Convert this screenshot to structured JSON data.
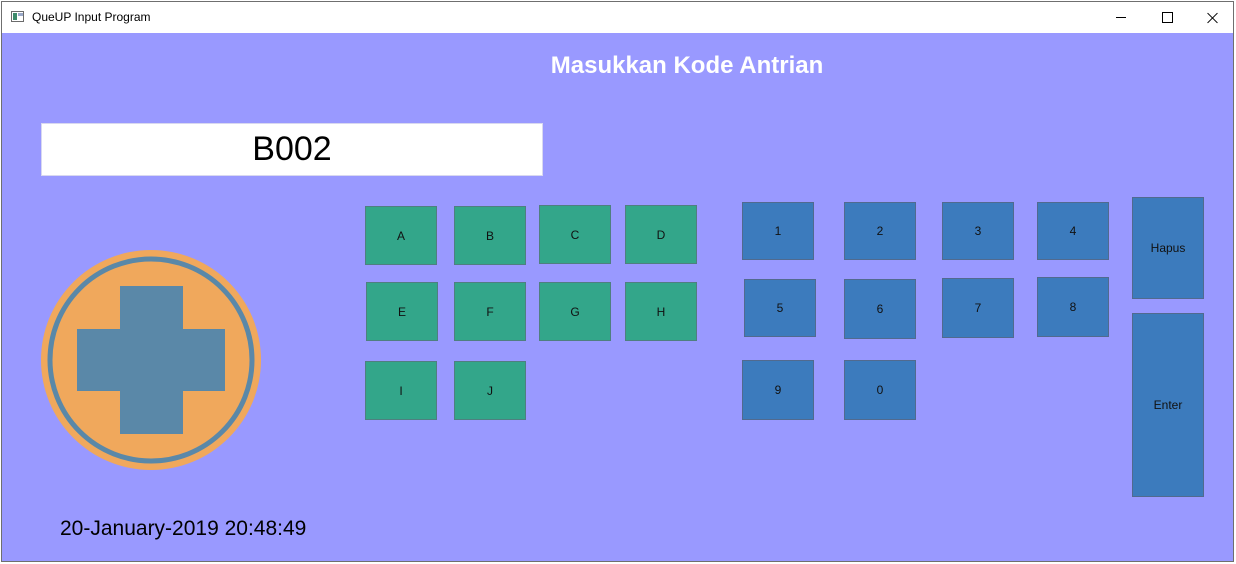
{
  "window": {
    "title": "QueUP Input Program",
    "icon": "app-window-icon",
    "controls": [
      "minimize-icon",
      "maximize-icon",
      "close-icon"
    ]
  },
  "heading": "Masukkan Kode Antrian",
  "code_input": {
    "value": "B002"
  },
  "logo": {
    "icon": "medical-cross-icon",
    "colors": {
      "ring": "#f0a85c",
      "cross": "#5a88a8"
    }
  },
  "letter_keys": [
    "A",
    "B",
    "C",
    "D",
    "E",
    "F",
    "G",
    "H",
    "I",
    "J"
  ],
  "number_keys": [
    "1",
    "2",
    "3",
    "4",
    "5",
    "6",
    "7",
    "8",
    "9",
    "0"
  ],
  "actions": {
    "delete_label": "Hapus",
    "enter_label": "Enter"
  },
  "datetime": "20-January-2019 20:48:49",
  "colors": {
    "background": "#9999ff",
    "letter_key": "#33a68a",
    "number_key": "#3c7bbd"
  }
}
